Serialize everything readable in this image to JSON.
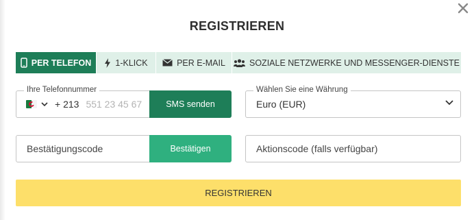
{
  "dialog": {
    "title": "REGISTRIEREN",
    "close_icon": "close-icon"
  },
  "tabs": [
    {
      "label": "PER TELEFON",
      "icon": "phone-icon",
      "active": true
    },
    {
      "label": "1-KLICK",
      "icon": "lightning-icon",
      "active": false
    },
    {
      "label": "PER E-MAIL",
      "icon": "envelope-icon",
      "active": false
    },
    {
      "label": "SOZIALE NETZWERKE UND MESSENGER-DIENSTE",
      "icon": "users-icon",
      "active": false
    }
  ],
  "phone": {
    "legend": "Ihre Telefonnummer",
    "country_flag": "algeria-flag-icon",
    "dial_code": "+ 213",
    "placeholder": "551 23 45 67",
    "value": "",
    "sms_button": "SMS senden"
  },
  "currency": {
    "legend": "Wählen Sie eine Währung",
    "selected": "Euro (EUR)"
  },
  "confirmation": {
    "placeholder": "Bestätigungscode",
    "button": "Bestätigen"
  },
  "promo": {
    "placeholder": "Aktionscode (falls verfügbar)"
  },
  "register_button": "REGISTRIEREN",
  "colors": {
    "accent": "#1e7e58",
    "accent_light": "#2fb07f",
    "tab_bg": "#dff0e8",
    "register_bg": "#fddf6a"
  }
}
